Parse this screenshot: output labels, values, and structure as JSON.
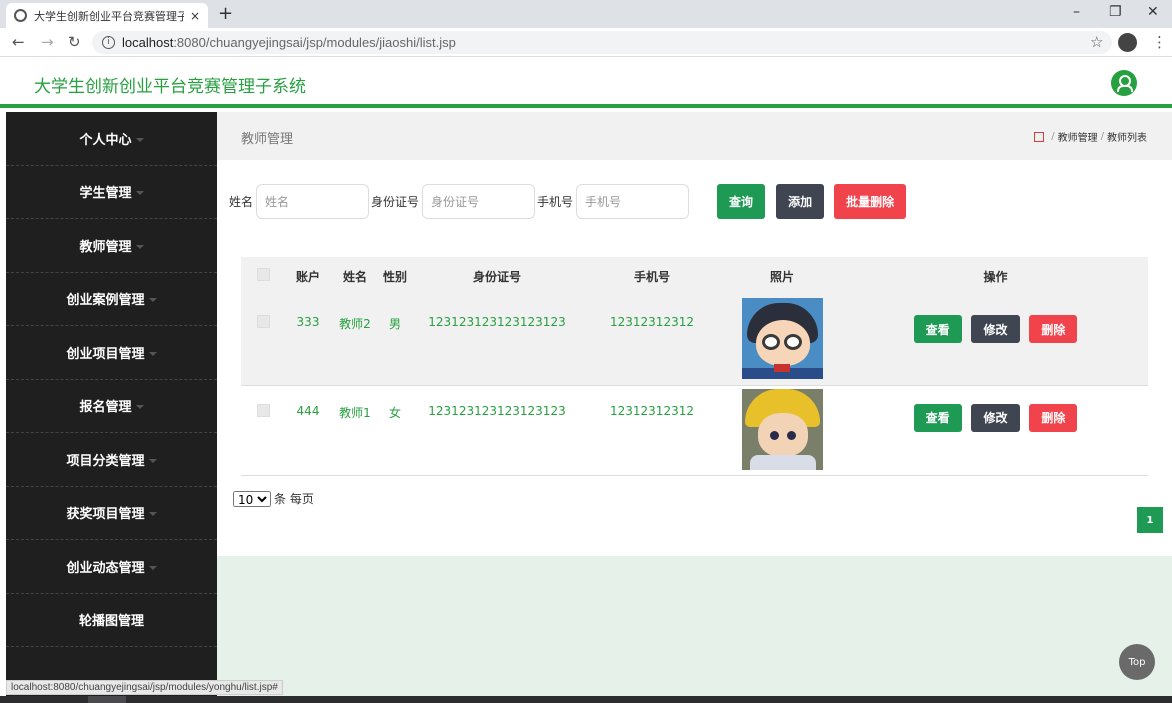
{
  "browser": {
    "tab_title": "大学生创新创业平台竞赛管理子系",
    "tab_close": "×",
    "new_tab": "+",
    "url_host": "localhost",
    "url_rest": ":8080/chuangyejingsai/jsp/modules/jiaoshi/list.jsp",
    "status_url": "localhost:8080/chuangyejingsai/jsp/modules/yonghu/list.jsp#"
  },
  "header": {
    "title": "大学生创新创业平台竞赛管理子系统"
  },
  "sidebar": {
    "items": [
      {
        "label": "个人中心"
      },
      {
        "label": "学生管理"
      },
      {
        "label": "教师管理"
      },
      {
        "label": "创业案例管理"
      },
      {
        "label": "创业项目管理"
      },
      {
        "label": "报名管理"
      },
      {
        "label": "项目分类管理"
      },
      {
        "label": "获奖项目管理"
      },
      {
        "label": "创业动态管理"
      },
      {
        "label": "轮播图管理"
      }
    ]
  },
  "page": {
    "title": "教师管理",
    "breadcrumb": [
      "教师管理",
      "教师列表"
    ],
    "breadcrumb_sep": "/"
  },
  "search": {
    "name_label": "姓名",
    "name_placeholder": "姓名",
    "id_label": "身份证号",
    "id_placeholder": "身份证号",
    "phone_label": "手机号",
    "phone_placeholder": "手机号",
    "query_btn": "查询",
    "add_btn": "添加",
    "batch_delete_btn": "批量删除"
  },
  "table": {
    "headers": [
      "账户",
      "姓名",
      "性别",
      "身份证号",
      "手机号",
      "照片",
      "操作"
    ],
    "rows": [
      {
        "account": "333",
        "name": "教师2",
        "gender": "男",
        "id_number": "123123123123123123",
        "phone": "12312312312"
      },
      {
        "account": "444",
        "name": "教师1",
        "gender": "女",
        "id_number": "123123123123123123",
        "phone": "12312312312"
      }
    ],
    "actions": {
      "view": "查看",
      "edit": "修改",
      "delete": "删除"
    }
  },
  "pagination": {
    "page_size": "10",
    "page_size_suffix": "条 每页",
    "current_page": "1"
  },
  "top_button": "Top",
  "colors": {
    "brand_green": "#27a040",
    "button_green": "#1e9a55",
    "button_dark": "#3f4652",
    "button_red": "#f0434b",
    "sidebar_bg": "#1f1f1f"
  }
}
